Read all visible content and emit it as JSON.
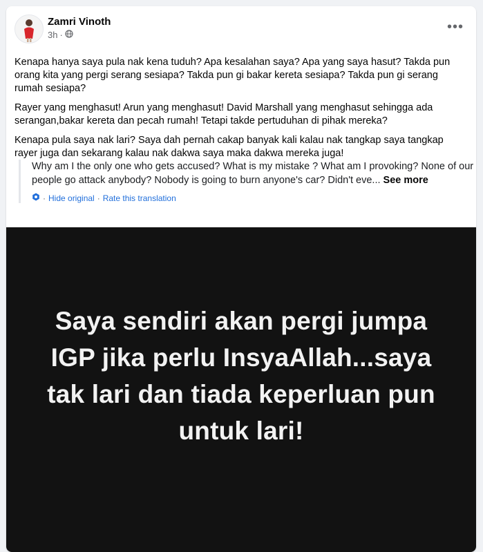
{
  "post": {
    "author": "Zamri Vinoth",
    "time": "3h",
    "visibility_icon": "globe-icon",
    "more_icon": "ellipsis-icon",
    "more_label": "•••",
    "paragraphs": [
      "Kenapa hanya saya pula nak kena tuduh? Apa kesalahan saya? Apa yang saya hasut? Takda pun orang kita yang pergi serang sesiapa? Takda pun gi bakar kereta sesiapa? Takda pun gi serang rumah sesiapa?",
      "Rayer yang menghasut! Arun yang menghasut! David Marshall yang menghasut sehingga ada serangan,bakar kereta dan pecah rumah! Tetapi takde pertuduhan di pihak mereka?",
      "Kenapa pula saya nak lari? Saya dah pernah cakap banyak kali kalau nak tangkap saya tangkap rayer juga dan sekarang kalau nak dakwa saya maka dakwa mereka juga!"
    ],
    "translation": {
      "text": "Why am I the only one who gets accused? What is my mistake ? What am I provoking? None of our people go attack anybody? Nobody is going to burn anyone's car? Didn't eve...",
      "see_more": "See more",
      "hide_original": "Hide original",
      "rate": "Rate this translation",
      "separator": "·"
    },
    "image_text": "Saya sendiri akan pergi jumpa IGP jika perlu InsyaAllah...saya tak lari dan tiada keperluan pun untuk lari!"
  },
  "colors": {
    "link": "#216fdb",
    "image_bg": "#121212"
  }
}
